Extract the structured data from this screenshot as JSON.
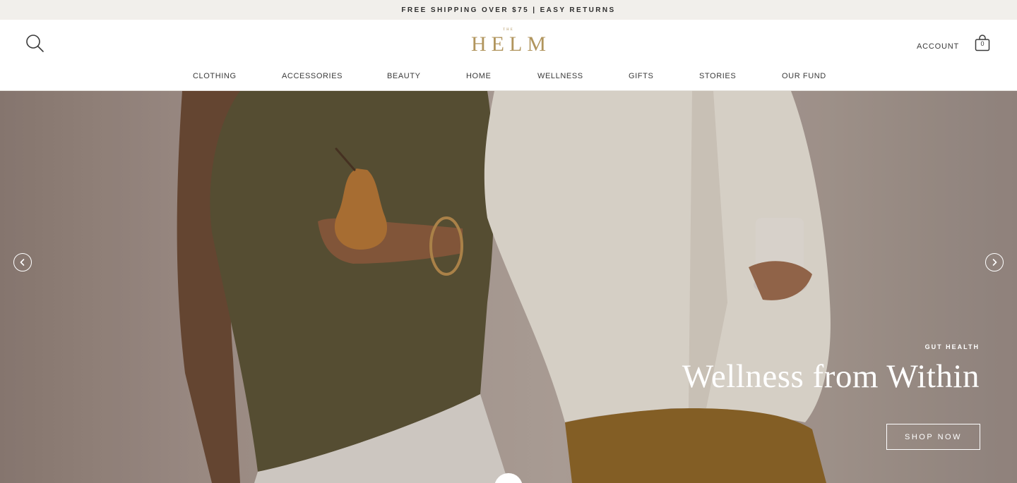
{
  "announcement": {
    "text": "FREE SHIPPING OVER $75 | EASY RETURNS"
  },
  "header": {
    "logo_small": "THE",
    "logo_main": "HELM",
    "account_label": "ACCOUNT",
    "cart_count": "0"
  },
  "nav": {
    "items": [
      {
        "label": "CLOTHING"
      },
      {
        "label": "ACCESSORIES"
      },
      {
        "label": "BEAUTY"
      },
      {
        "label": "HOME"
      },
      {
        "label": "WELLNESS"
      },
      {
        "label": "GIFTS"
      },
      {
        "label": "STORIES"
      },
      {
        "label": "OUR FUND"
      }
    ]
  },
  "hero": {
    "eyebrow": "GUT HEALTH",
    "headline": "Wellness from Within",
    "cta_label": "SHOP NOW",
    "icons": {
      "prev": "chevron-left-icon",
      "next": "chevron-right-icon"
    }
  },
  "colors": {
    "announce_bg": "#f1efeb",
    "logo_gold": "#b1955d",
    "text": "#3a3a3a",
    "white": "#ffffff"
  }
}
